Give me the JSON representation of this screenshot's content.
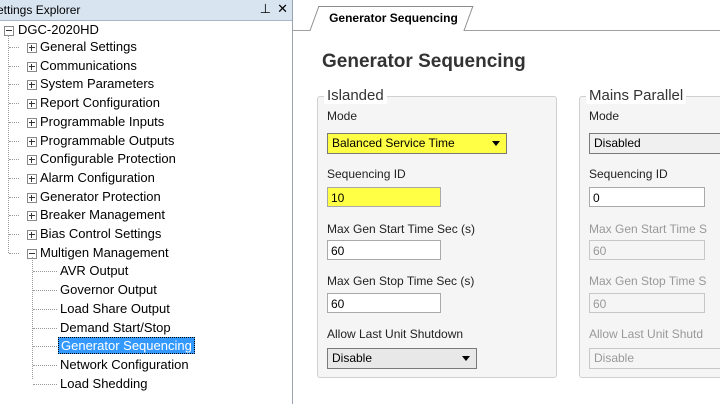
{
  "explorer": {
    "title": "ettings Explorer",
    "pin_icon": "pin-icon",
    "close_icon": "close-icon",
    "root": "DGC-2020HD",
    "items": [
      {
        "label": "General Settings",
        "expander": "plus"
      },
      {
        "label": "Communications",
        "expander": "plus"
      },
      {
        "label": "System Parameters",
        "expander": "plus"
      },
      {
        "label": "Report Configuration",
        "expander": "plus"
      },
      {
        "label": "Programmable Inputs",
        "expander": "plus"
      },
      {
        "label": "Programmable Outputs",
        "expander": "plus"
      },
      {
        "label": "Configurable Protection",
        "expander": "plus"
      },
      {
        "label": "Alarm Configuration",
        "expander": "plus"
      },
      {
        "label": "Generator Protection",
        "expander": "plus"
      },
      {
        "label": "Breaker Management",
        "expander": "plus"
      },
      {
        "label": "Bias Control Settings",
        "expander": "plus"
      },
      {
        "label": "Multigen Management",
        "expander": "minus"
      }
    ],
    "children": [
      {
        "label": "AVR Output"
      },
      {
        "label": "Governor Output"
      },
      {
        "label": "Load Share Output"
      },
      {
        "label": "Demand Start/Stop"
      },
      {
        "label": "Generator Sequencing",
        "selected": true
      },
      {
        "label": "Network Configuration"
      },
      {
        "label": "Load Shedding"
      }
    ]
  },
  "tab": {
    "label": "Generator Sequencing"
  },
  "page": {
    "title": "Generator Sequencing",
    "highlight_color": "#ffff45",
    "islanded": {
      "title": "Islanded",
      "mode_label": "Mode",
      "mode_value": "Balanced Service Time",
      "seq_id_label": "Sequencing ID",
      "seq_id_value": "10",
      "max_start_label": "Max Gen Start Time Sec (s)",
      "max_start_value": "60",
      "max_stop_label": "Max Gen Stop Time Sec (s)",
      "max_stop_value": "60",
      "allow_last_label": "Allow Last Unit Shutdown",
      "allow_last_value": "Disable"
    },
    "mains": {
      "title": "Mains Parallel",
      "mode_label": "Mode",
      "mode_value": "Disabled",
      "seq_id_label": "Sequencing ID",
      "seq_id_value": "0",
      "max_start_label": "Max Gen Start Time S",
      "max_start_value": "60",
      "max_stop_label": "Max Gen Stop Time S",
      "max_stop_value": "60",
      "allow_last_label": "Allow Last Unit Shutd",
      "allow_last_value": "Disable"
    }
  }
}
